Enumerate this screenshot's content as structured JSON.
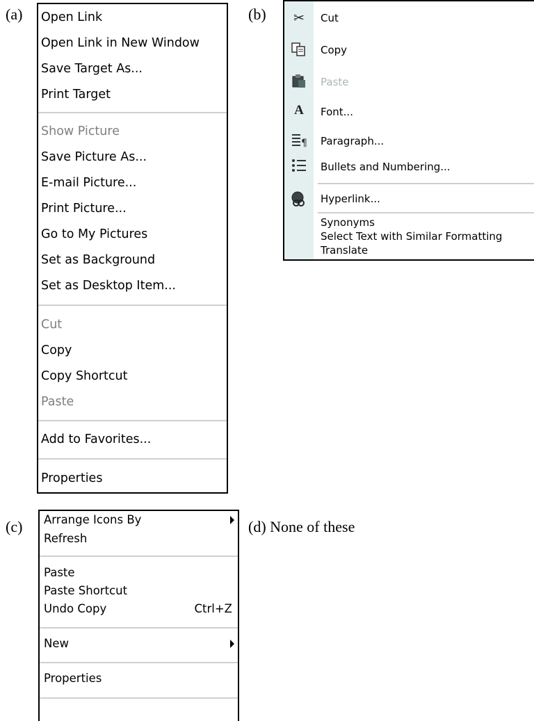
{
  "options": {
    "a": "(a)",
    "b": "(b)",
    "c": "(c)",
    "d": "(d) None of these"
  },
  "menu_a": {
    "items": [
      {
        "label": "Open Link",
        "disabled": false
      },
      {
        "label": "Open Link in New Window",
        "disabled": false
      },
      {
        "label": "Save Target As...",
        "disabled": false
      },
      {
        "label": "Print Target",
        "disabled": false
      },
      {
        "label": "Show Picture",
        "disabled": true
      },
      {
        "label": "Save Picture As...",
        "disabled": false
      },
      {
        "label": "E-mail Picture...",
        "disabled": false
      },
      {
        "label": "Print Picture...",
        "disabled": false
      },
      {
        "label": "Go to My Pictures",
        "disabled": false
      },
      {
        "label": "Set as Background",
        "disabled": false
      },
      {
        "label": "Set as Desktop Item...",
        "disabled": false
      },
      {
        "label": "Cut",
        "disabled": true
      },
      {
        "label": "Copy",
        "disabled": false
      },
      {
        "label": "Copy Shortcut",
        "disabled": false
      },
      {
        "label": "Paste",
        "disabled": true
      },
      {
        "label": "Add to Favorites...",
        "disabled": false
      },
      {
        "label": "Properties",
        "disabled": false
      }
    ]
  },
  "menu_b": {
    "items": [
      {
        "label": "Cut",
        "icon": "scissors-icon",
        "disabled": false
      },
      {
        "label": "Copy",
        "icon": "copy-icon",
        "disabled": false
      },
      {
        "label": "Paste",
        "icon": "paste-icon",
        "disabled": true
      },
      {
        "label": "Font...",
        "icon": "font-icon",
        "disabled": false
      },
      {
        "label": "Paragraph...",
        "icon": "paragraph-icon",
        "disabled": false
      },
      {
        "label": "Bullets and Numbering...",
        "icon": "bullets-icon",
        "disabled": false
      },
      {
        "label": "Hyperlink...",
        "icon": "hyperlink-icon",
        "disabled": false
      },
      {
        "label": "Synonyms",
        "icon": "",
        "disabled": false
      },
      {
        "label": "Select Text with Similar Formatting",
        "icon": "",
        "disabled": false
      },
      {
        "label": "Translate",
        "icon": "",
        "disabled": false
      }
    ]
  },
  "menu_c": {
    "items": [
      {
        "label": "Arrange Icons By",
        "submenu": true
      },
      {
        "label": "Refresh"
      },
      {
        "label": "Paste"
      },
      {
        "label": "Paste Shortcut"
      },
      {
        "label": "Undo Copy",
        "shortcut": "Ctrl+Z"
      },
      {
        "label": "New",
        "submenu": true
      },
      {
        "label": "Properties"
      }
    ]
  }
}
